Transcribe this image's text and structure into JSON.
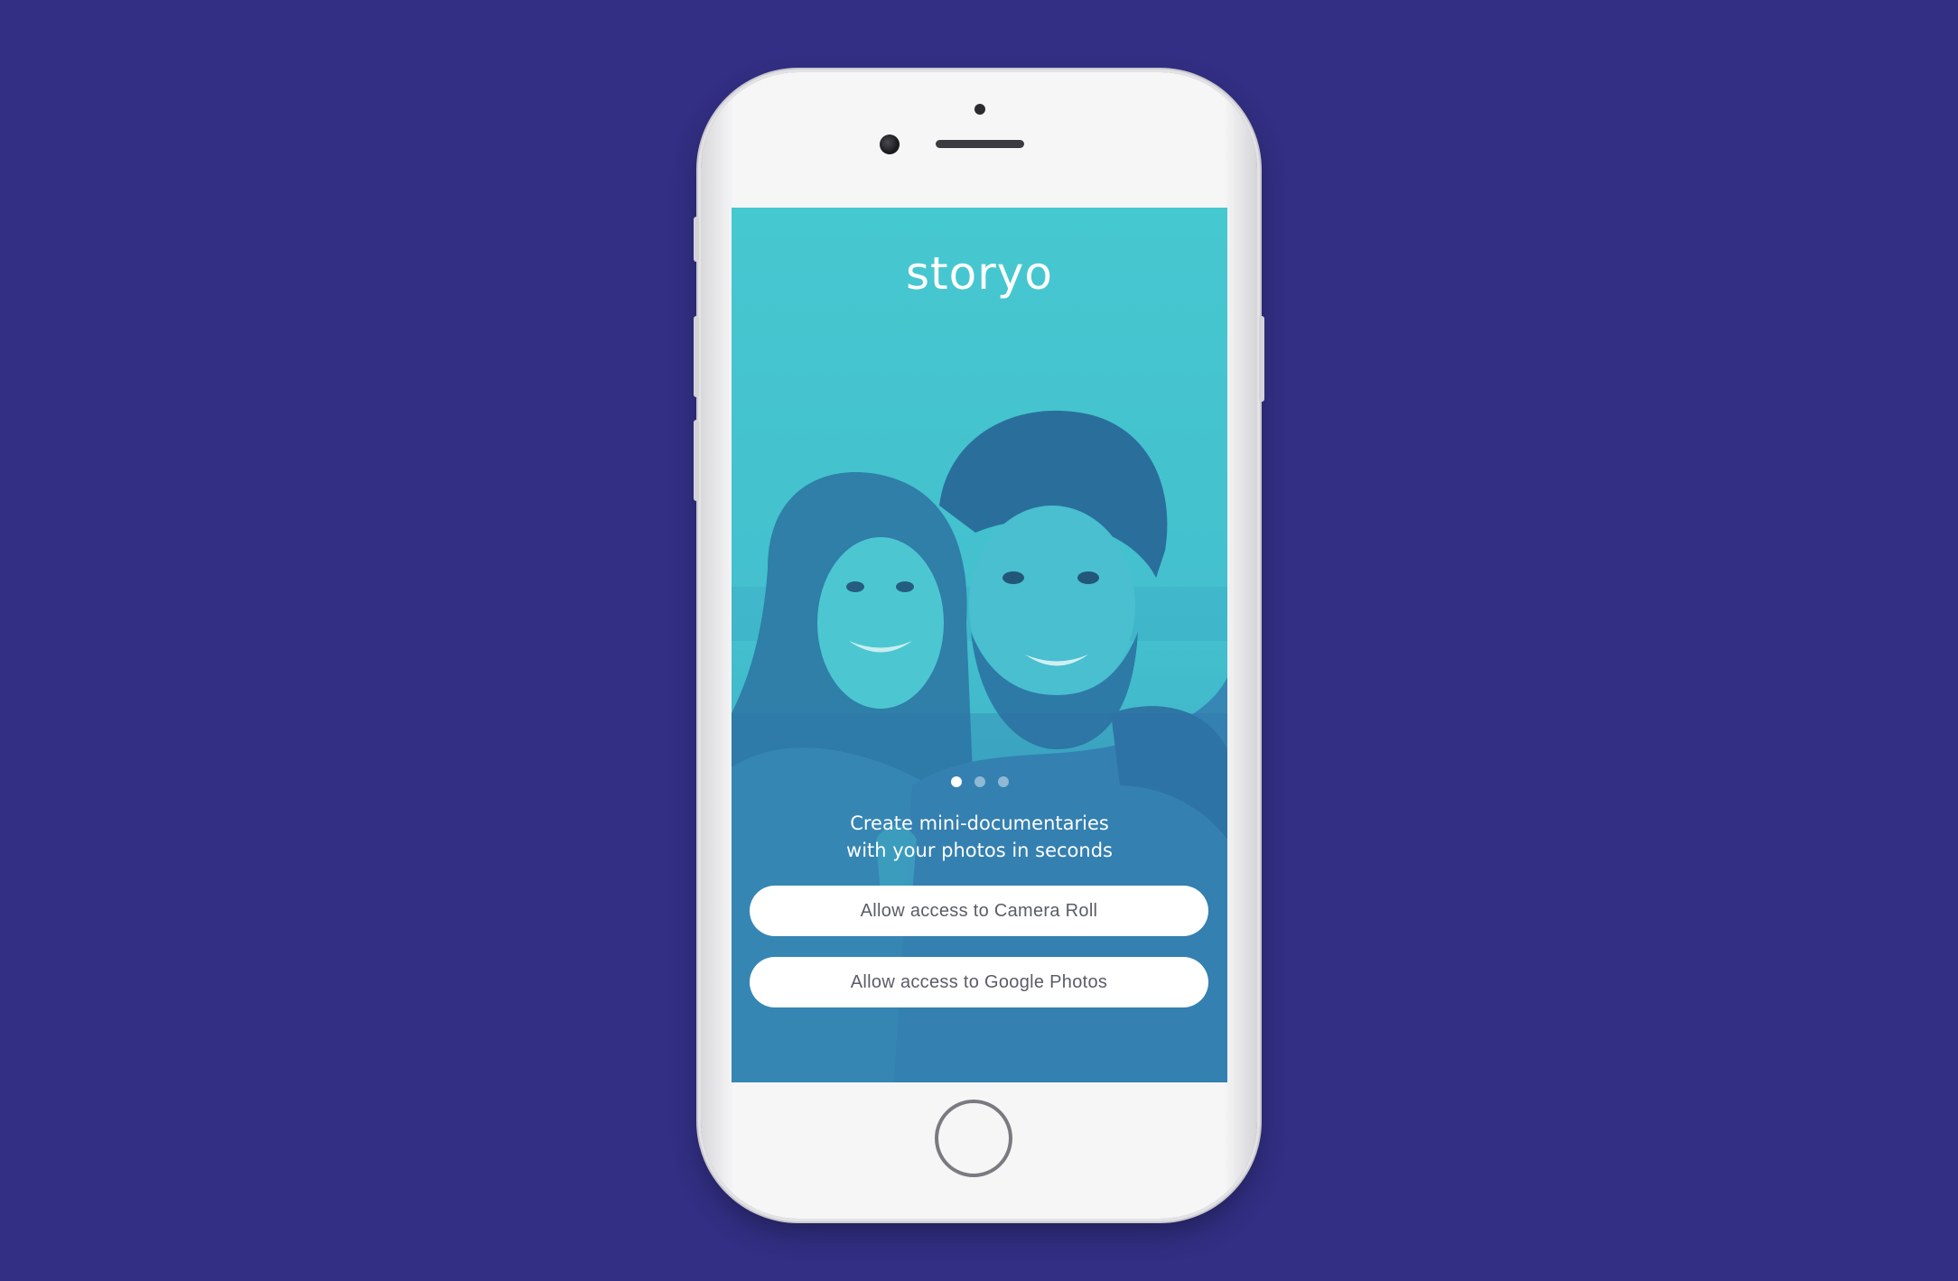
{
  "colors": {
    "background": "#322f84",
    "screen_teal": "#44c6cf",
    "screen_deep": "#3687b6",
    "button_bg": "#ffffff",
    "button_text": "#5a5d66"
  },
  "app": {
    "logo": "storyo",
    "pager": {
      "pages": 3,
      "active_index": 0
    },
    "tagline_lines": [
      "Create mini-documentaries",
      "with your photos in seconds"
    ],
    "buttons": {
      "camera_roll": "Allow access to Camera Roll",
      "google_photos": "Allow access to Google Photos"
    }
  },
  "icons": {
    "home_button": "home-button-ring",
    "front_camera": "camera-lens-icon"
  }
}
